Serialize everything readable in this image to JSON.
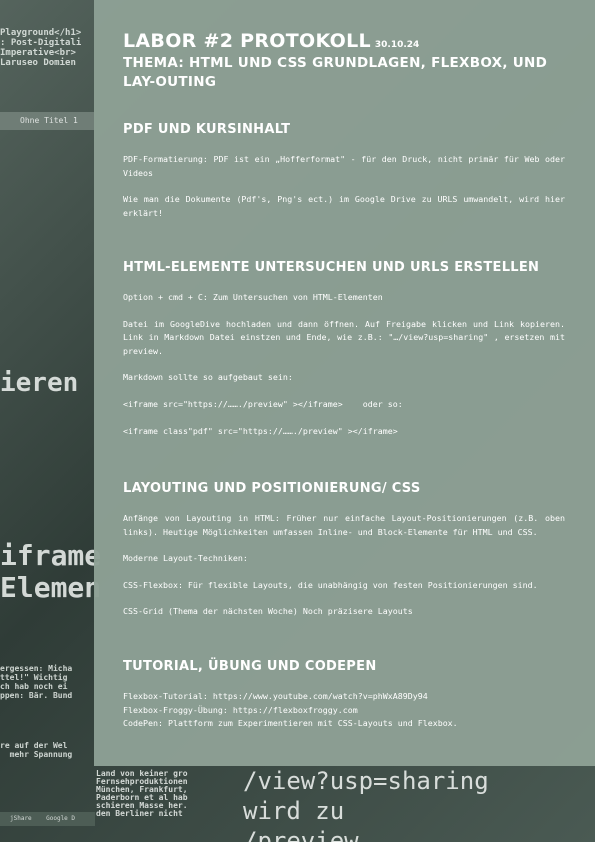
{
  "background": {
    "code_top": "Playground</h1>\n: Post-Digitali\nImperative<br>\nLaruseo Domien",
    "tab_label": "Ohne Titel 1",
    "big_fragment_1": "ieren",
    "big_fragment_2": "iframe\nElemen",
    "mid_fragment": "ergessen: Micha\nttel!\" Wichtig\nch hab noch ei\nppen: Bär. Bund",
    "low_fragment": "re auf der Wel\n  mehr Spannung",
    "bottom_left_text": "Land von keiner gro\nFernsehproduktionen\nMünchen, Frankfurt,\nPaderborn et al hab\nschieren Masse her.\nden Berliner nicht",
    "bottom_big": "/view?usp=sharing\nwird zu\n/preview",
    "dock_text": "jShare    Google D"
  },
  "header": {
    "title": "LABOR #2 PROTOKOLL",
    "date": "30.10.24",
    "topic": "THEMA: HTML UND CSS GRUNDLAGEN, FLEXBOX, UND LAY-OUTING"
  },
  "sections": {
    "pdf": {
      "heading": "PDF UND KURSINHALT",
      "p1": "PDF-Formatierung: PDF ist ein „Hofferformat\" - für den Druck, nicht primär für Web oder Videos",
      "p2": "Wie man die Dokumente (Pdf's, Png's ect.) im Google Drive zu URLS umwandelt, wird hier erklärt!"
    },
    "html": {
      "heading": "HTML-ELEMENTE UNTERSUCHEN UND URLS ERSTELLEN",
      "p1": "Option + cmd + C: Zum Untersuchen von HTML-Elementen",
      "p2": "Datei im GoogleDive hochladen und dann öffnen. Auf Freigabe klicken und Link kopieren. Link in Markdown Datei einstzen und Ende, wie z.B.: \"…/view?usp=sharing\" , ersetzen mit preview.",
      "p3": "Markdown sollte so aufgebaut sein:",
      "code1": "<iframe src=\"https://……./preview\" ></iframe>    oder so:",
      "code2": "<iframe class\"pdf\" src=\"https://……./preview\" ></iframe>"
    },
    "layout": {
      "heading": "LAYOUTING UND POSITIONIERUNG/ CSS",
      "p1": "Anfänge von Layouting in HTML: Früher nur einfache Layout-Positionierungen (z.B. oben links). Heutige Möglichkeiten umfassen Inline- und Block-Elemente für HTML und CSS.",
      "p2": "Moderne Layout-Techniken:",
      "p3": "CSS-Flexbox: Für flexible Layouts, die unabhängig von festen Positionierungen sind.",
      "p4": "CSS-Grid (Thema der nächsten Woche) Noch präzisere Layouts"
    },
    "tutorial": {
      "heading": "TUTORIAL, ÜBUNG UND CODEPEN",
      "l1": "Flexbox-Tutorial: https://www.youtube.com/watch?v=phWxA89Dy94",
      "l2": "Flexbox-Froggy-Übung: https://flexboxfroggy.com",
      "l3": "CodePen: Plattform zum Experimentieren mit CSS-Layouts und Flexbox."
    }
  },
  "colors": {
    "panel": "#8da095",
    "text": "#ffffff"
  }
}
